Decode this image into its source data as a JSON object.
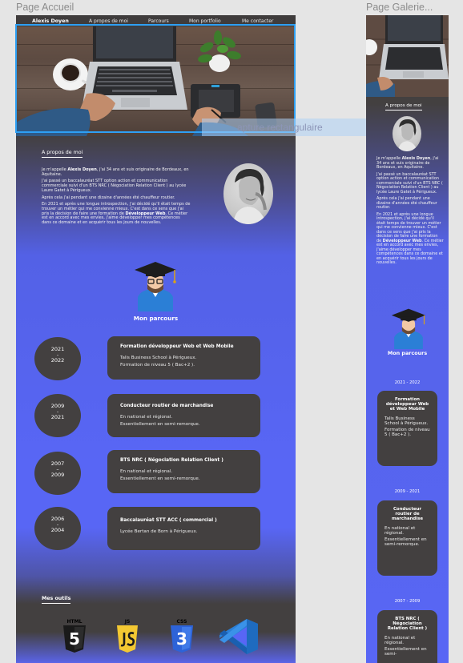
{
  "frames": {
    "home_label": "Page Accueil",
    "gallery_label": "Page Galerie..."
  },
  "nav": {
    "brand": "Alexis Doyen",
    "items": [
      "A propos de moi",
      "Parcours",
      "Mon portfolio",
      "Me contacter"
    ]
  },
  "capture_label": "apture rectangulaire",
  "about": {
    "title": "A propos de moi",
    "p1_pre": "Je m'appelle ",
    "p1_name": "Alexis Doyen",
    "p1_post": ", j'ai 34 ans et suis originaire de Bordeaux, en Aquitaine.",
    "p2": "J'ai passé un baccalauréat STT option action et communication commerciale suivi d'un BTS NRC ( Négociation Relation Client ) au lycée Laure Gatet à Périgueux.",
    "p3": "Après cela j'ai pendant une dizaine d'années été chauffeur routier.",
    "p4_pre": "En 2021 et après une longue introspection, j'ai décidé qu'il était temps de trouver un métier qui me convienne mieux. C'est dans ce sens que j'ai pris la décision de faire une formation de ",
    "p4_bold": "Développeur Web",
    "p4_post": ". Ce métier est en accord avec mes envies, j'aime développer mes compétences dans ce domaine et en acquérir tous les jours de nouvelles."
  },
  "parcours": {
    "title": "Mon parcours",
    "items": [
      {
        "start": "2021",
        "sep": "-",
        "end": "2022",
        "title": "Formation développeur Web et Web Mobile",
        "lines": [
          "Talis Business School à Périgueux.",
          "Formation de niveau 5 ( Bac+2 )."
        ]
      },
      {
        "start": "2009",
        "sep": "-",
        "end": "2021",
        "title": "Conducteur routier de marchandise",
        "lines": [
          "En national et régional.",
          "Essentiellement en semi-remorque."
        ]
      },
      {
        "start": "2007",
        "sep": "–",
        "end": "2009",
        "title": "BTS NRC ( Négociation Relation Client )",
        "lines": [
          "En national et régional.",
          "Essentiellement en semi-remorque."
        ]
      },
      {
        "start": "2006",
        "sep": "-",
        "end": "2004",
        "title": "Baccalauréat STT ACC ( commercial )",
        "lines": [
          "Lycée Bertan de Born à Périgueux."
        ]
      }
    ]
  },
  "tools": {
    "title": "Mes outils",
    "items": [
      {
        "name": "HTML",
        "number": "5",
        "color": "#1a1a1a"
      },
      {
        "name": "JS",
        "number": "",
        "color": "#f3c832"
      },
      {
        "name": "CSS",
        "number": "3",
        "color": "#2d63d8"
      },
      {
        "name": "VS Code",
        "number": "",
        "color": "#2b7fd6"
      }
    ]
  },
  "gallery": {
    "about_title": "A propos de moi",
    "p1_pre": "Je m'appelle ",
    "p1_name": "Alexis Doyen",
    "p1_post": ", j'ai 34 ans et suis originaire de Bordeaux, en Aquitaine.",
    "p2": "J'ai passé un baccalauréat STT option action et communication commerciale suivi d'un BTS NRC ( Négociation Relation Client ) au lycée Laure Gatet à Périgueux.",
    "p3": "Après cela j'ai pendant une dizaine d'années été chauffeur routier.",
    "p4_pre": "En 2021 et après une longue introspection, j'ai décidé qu'il était temps de trouver un métier qui me convienne mieux. C'est dans ce sens que j'ai pris la décision de faire une formation de ",
    "p4_bold": "Développeur Web",
    "p4_post": ". Ce métier est en accord avec mes envies, j'aime développer mes compétences dans ce domaine et en acquérir tous les jours de nouvelles.",
    "parcours_title": "Mon parcours",
    "items": [
      {
        "dates": "2021 - 2022",
        "title": "Formation développeur Web et Web Mobile",
        "lines": [
          "Talis Business School à Périgueux.",
          "Formation de niveau 5 ( Bac+2 )."
        ]
      },
      {
        "dates": "2009 - 2021",
        "title": "Conducteur routier de marchandise",
        "lines": [
          "En national et régional.",
          "Essentiellement en semi-remorque."
        ]
      },
      {
        "dates": "2007 - 2009",
        "title": "BTS NRC ( Négociation Relation Client )",
        "lines": [
          "En national et régional.",
          "Essentiellement en semi-"
        ]
      }
    ]
  },
  "colors": {
    "dark": "#434040",
    "accent_blue": "#5866f5",
    "selection": "#2ea0f4"
  }
}
